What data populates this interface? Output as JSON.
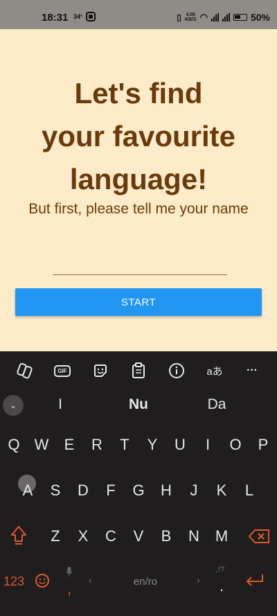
{
  "status": {
    "time": "18:31",
    "temp": "34°",
    "speed_value": "4.00",
    "speed_unit": "KB/S",
    "battery": "50%"
  },
  "app": {
    "headline_line1": "Let's find",
    "headline_line2": "your favourite",
    "headline_line3": "language!",
    "subtitle": "But first, please tell me your name",
    "name_value": "",
    "start_label": "START",
    "colors": {
      "background": "#fdebc9",
      "text": "#6b3a0a",
      "button": "#2196f3"
    }
  },
  "keyboard": {
    "toolbar": {
      "gif_label": "GIF",
      "translate_label": "aあ",
      "more_label": "···"
    },
    "suggestions": [
      "I",
      "Nu",
      "Da"
    ],
    "row1": [
      "Q",
      "W",
      "E",
      "R",
      "T",
      "Y",
      "U",
      "I",
      "O",
      "P"
    ],
    "row2": [
      "A",
      "S",
      "D",
      "F",
      "G",
      "H",
      "J",
      "K",
      "L"
    ],
    "row3": [
      "Z",
      "X",
      "C",
      "V",
      "B",
      "N",
      "M"
    ],
    "bottom": {
      "numbers_label": "123",
      "comma": ",",
      "space_label": "en/ro",
      "period": ".",
      "punct_hint": ",!?"
    },
    "icons": [
      "copilot-icon",
      "gif-icon",
      "sticker-icon",
      "clipboard-icon",
      "info-icon",
      "translate-icon",
      "more-icon",
      "collapse-icon",
      "shift-icon",
      "backspace-icon",
      "emoji-icon",
      "mic-icon",
      "enter-icon"
    ],
    "accent_color": "#e0592a"
  }
}
